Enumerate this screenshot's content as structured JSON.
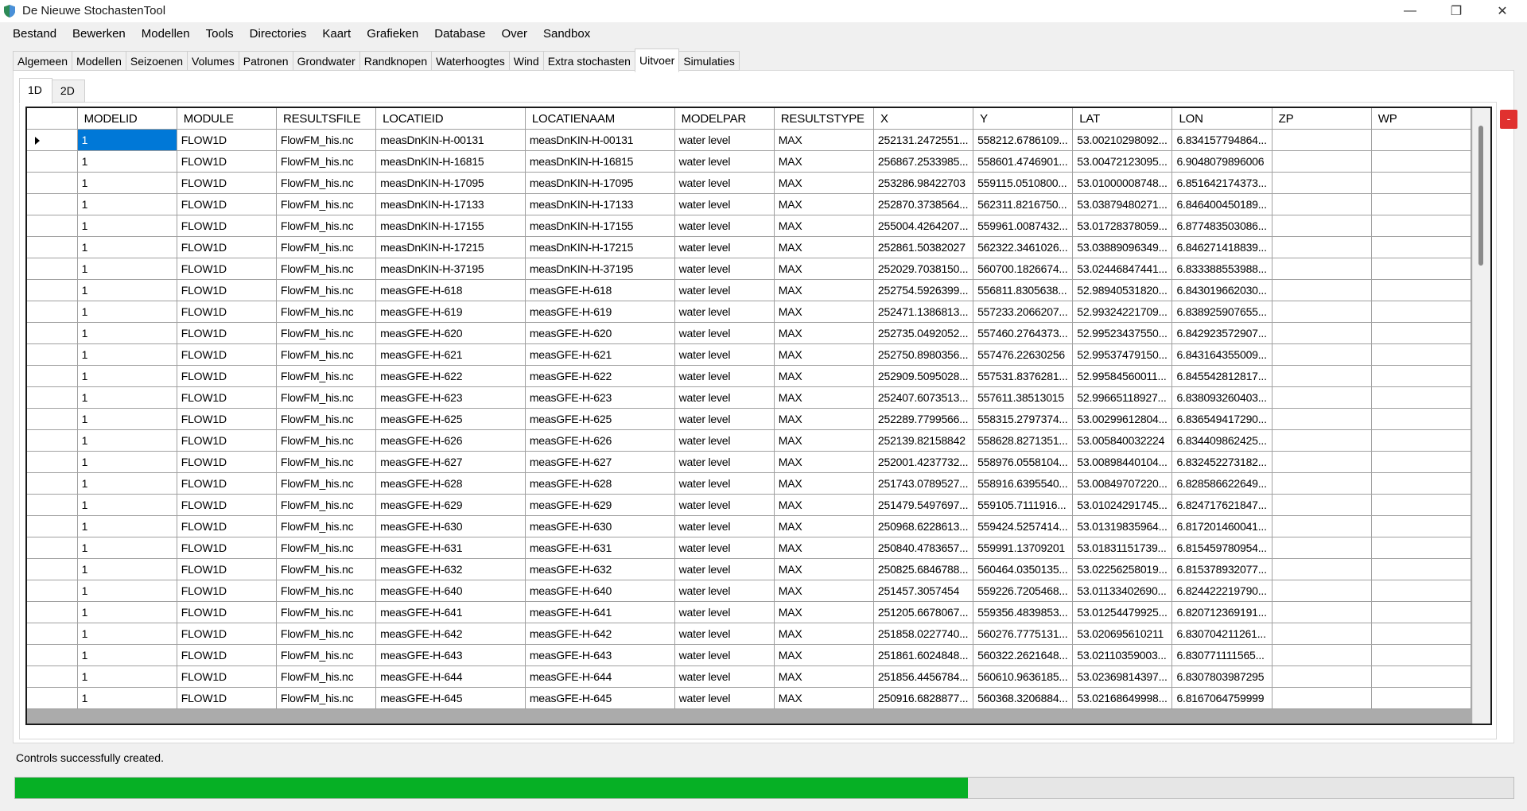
{
  "window": {
    "title": "De Nieuwe StochastenTool",
    "minimize": "—",
    "restore": "❐",
    "close": "✕"
  },
  "menu": [
    "Bestand",
    "Bewerken",
    "Modellen",
    "Tools",
    "Directories",
    "Kaart",
    "Grafieken",
    "Database",
    "Over",
    "Sandbox"
  ],
  "tabs": [
    "Algemeen",
    "Modellen",
    "Seizoenen",
    "Volumes",
    "Patronen",
    "Grondwater",
    "Randknopen",
    "Waterhoogtes",
    "Wind",
    "Extra stochasten",
    "Uitvoer",
    "Simulaties"
  ],
  "active_tab": "Uitvoer",
  "subtabs": [
    "1D",
    "2D"
  ],
  "active_subtab": "1D",
  "grid": {
    "columns": [
      "MODELID",
      "MODULE",
      "RESULTSFILE",
      "LOCATIEID",
      "LOCATIENAAM",
      "MODELPAR",
      "RESULTSTYPE",
      "X",
      "Y",
      "LAT",
      "LON",
      "ZP",
      "WP"
    ],
    "rows": [
      [
        "1",
        "FLOW1D",
        "FlowFM_his.nc",
        "measDnKIN-H-00131",
        "measDnKIN-H-00131",
        "water level",
        "MAX",
        "252131.2472551...",
        "558212.6786109...",
        "53.00210298092...",
        "6.834157794864...",
        "",
        ""
      ],
      [
        "1",
        "FLOW1D",
        "FlowFM_his.nc",
        "measDnKIN-H-16815",
        "measDnKIN-H-16815",
        "water level",
        "MAX",
        "256867.2533985...",
        "558601.4746901...",
        "53.00472123095...",
        "6.9048079896006",
        "",
        ""
      ],
      [
        "1",
        "FLOW1D",
        "FlowFM_his.nc",
        "measDnKIN-H-17095",
        "measDnKIN-H-17095",
        "water level",
        "MAX",
        "253286.98422703",
        "559115.0510800...",
        "53.01000008748...",
        "6.851642174373...",
        "",
        ""
      ],
      [
        "1",
        "FLOW1D",
        "FlowFM_his.nc",
        "measDnKIN-H-17133",
        "measDnKIN-H-17133",
        "water level",
        "MAX",
        "252870.3738564...",
        "562311.8216750...",
        "53.03879480271...",
        "6.846400450189...",
        "",
        ""
      ],
      [
        "1",
        "FLOW1D",
        "FlowFM_his.nc",
        "measDnKIN-H-17155",
        "measDnKIN-H-17155",
        "water level",
        "MAX",
        "255004.4264207...",
        "559961.0087432...",
        "53.01728378059...",
        "6.877483503086...",
        "",
        ""
      ],
      [
        "1",
        "FLOW1D",
        "FlowFM_his.nc",
        "measDnKIN-H-17215",
        "measDnKIN-H-17215",
        "water level",
        "MAX",
        "252861.50382027",
        "562322.3461026...",
        "53.03889096349...",
        "6.846271418839...",
        "",
        ""
      ],
      [
        "1",
        "FLOW1D",
        "FlowFM_his.nc",
        "measDnKIN-H-37195",
        "measDnKIN-H-37195",
        "water level",
        "MAX",
        "252029.7038150...",
        "560700.1826674...",
        "53.02446847441...",
        "6.833388553988...",
        "",
        ""
      ],
      [
        "1",
        "FLOW1D",
        "FlowFM_his.nc",
        "measGFE-H-618",
        "measGFE-H-618",
        "water level",
        "MAX",
        "252754.5926399...",
        "556811.8305638...",
        "52.98940531820...",
        "6.843019662030...",
        "",
        ""
      ],
      [
        "1",
        "FLOW1D",
        "FlowFM_his.nc",
        "measGFE-H-619",
        "measGFE-H-619",
        "water level",
        "MAX",
        "252471.1386813...",
        "557233.2066207...",
        "52.99324221709...",
        "6.838925907655...",
        "",
        ""
      ],
      [
        "1",
        "FLOW1D",
        "FlowFM_his.nc",
        "measGFE-H-620",
        "measGFE-H-620",
        "water level",
        "MAX",
        "252735.0492052...",
        "557460.2764373...",
        "52.99523437550...",
        "6.842923572907...",
        "",
        ""
      ],
      [
        "1",
        "FLOW1D",
        "FlowFM_his.nc",
        "measGFE-H-621",
        "measGFE-H-621",
        "water level",
        "MAX",
        "252750.8980356...",
        "557476.22630256",
        "52.99537479150...",
        "6.843164355009...",
        "",
        ""
      ],
      [
        "1",
        "FLOW1D",
        "FlowFM_his.nc",
        "measGFE-H-622",
        "measGFE-H-622",
        "water level",
        "MAX",
        "252909.5095028...",
        "557531.8376281...",
        "52.99584560011...",
        "6.845542812817...",
        "",
        ""
      ],
      [
        "1",
        "FLOW1D",
        "FlowFM_his.nc",
        "measGFE-H-623",
        "measGFE-H-623",
        "water level",
        "MAX",
        "252407.6073513...",
        "557611.38513015",
        "52.99665118927...",
        "6.838093260403...",
        "",
        ""
      ],
      [
        "1",
        "FLOW1D",
        "FlowFM_his.nc",
        "measGFE-H-625",
        "measGFE-H-625",
        "water level",
        "MAX",
        "252289.7799566...",
        "558315.2797374...",
        "53.00299612804...",
        "6.836549417290...",
        "",
        ""
      ],
      [
        "1",
        "FLOW1D",
        "FlowFM_his.nc",
        "measGFE-H-626",
        "measGFE-H-626",
        "water level",
        "MAX",
        "252139.82158842",
        "558628.8271351...",
        "53.005840032224",
        "6.834409862425...",
        "",
        ""
      ],
      [
        "1",
        "FLOW1D",
        "FlowFM_his.nc",
        "measGFE-H-627",
        "measGFE-H-627",
        "water level",
        "MAX",
        "252001.4237732...",
        "558976.0558104...",
        "53.00898440104...",
        "6.832452273182...",
        "",
        ""
      ],
      [
        "1",
        "FLOW1D",
        "FlowFM_his.nc",
        "measGFE-H-628",
        "measGFE-H-628",
        "water level",
        "MAX",
        "251743.0789527...",
        "558916.6395540...",
        "53.00849707220...",
        "6.828586622649...",
        "",
        ""
      ],
      [
        "1",
        "FLOW1D",
        "FlowFM_his.nc",
        "measGFE-H-629",
        "measGFE-H-629",
        "water level",
        "MAX",
        "251479.5497697...",
        "559105.7111916...",
        "53.01024291745...",
        "6.824717621847...",
        "",
        ""
      ],
      [
        "1",
        "FLOW1D",
        "FlowFM_his.nc",
        "measGFE-H-630",
        "measGFE-H-630",
        "water level",
        "MAX",
        "250968.6228613...",
        "559424.5257414...",
        "53.01319835964...",
        "6.817201460041...",
        "",
        ""
      ],
      [
        "1",
        "FLOW1D",
        "FlowFM_his.nc",
        "measGFE-H-631",
        "measGFE-H-631",
        "water level",
        "MAX",
        "250840.4783657...",
        "559991.13709201",
        "53.01831151739...",
        "6.815459780954...",
        "",
        ""
      ],
      [
        "1",
        "FLOW1D",
        "FlowFM_his.nc",
        "measGFE-H-632",
        "measGFE-H-632",
        "water level",
        "MAX",
        "250825.6846788...",
        "560464.0350135...",
        "53.02256258019...",
        "6.815378932077...",
        "",
        ""
      ],
      [
        "1",
        "FLOW1D",
        "FlowFM_his.nc",
        "measGFE-H-640",
        "measGFE-H-640",
        "water level",
        "MAX",
        "251457.3057454",
        "559226.7205468...",
        "53.01133402690...",
        "6.824422219790...",
        "",
        ""
      ],
      [
        "1",
        "FLOW1D",
        "FlowFM_his.nc",
        "measGFE-H-641",
        "measGFE-H-641",
        "water level",
        "MAX",
        "251205.6678067...",
        "559356.4839853...",
        "53.01254479925...",
        "6.820712369191...",
        "",
        ""
      ],
      [
        "1",
        "FLOW1D",
        "FlowFM_his.nc",
        "measGFE-H-642",
        "measGFE-H-642",
        "water level",
        "MAX",
        "251858.0227740...",
        "560276.7775131...",
        "53.020695610211",
        "6.830704211261...",
        "",
        ""
      ],
      [
        "1",
        "FLOW1D",
        "FlowFM_his.nc",
        "measGFE-H-643",
        "measGFE-H-643",
        "water level",
        "MAX",
        "251861.6024848...",
        "560322.2621648...",
        "53.02110359003...",
        "6.830771111565...",
        "",
        ""
      ],
      [
        "1",
        "FLOW1D",
        "FlowFM_his.nc",
        "measGFE-H-644",
        "measGFE-H-644",
        "water level",
        "MAX",
        "251856.4456784...",
        "560610.9636185...",
        "53.02369814397...",
        "6.8307803987295",
        "",
        ""
      ],
      [
        "1",
        "FLOW1D",
        "FlowFM_his.nc",
        "measGFE-H-645",
        "measGFE-H-645",
        "water level",
        "MAX",
        "250916.6828877...",
        "560368.3206884...",
        "53.02168649998...",
        "6.8167064759999",
        "",
        ""
      ]
    ]
  },
  "side_button": "-",
  "status": {
    "message": "Controls successfully created.",
    "progress_fraction": 0.636
  },
  "colors": {
    "progress": "#06b025",
    "selection": "#0078d7",
    "side_button": "#e0312f"
  }
}
